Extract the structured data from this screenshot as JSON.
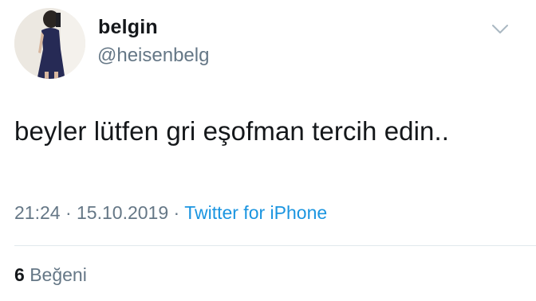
{
  "tweet": {
    "author": {
      "display_name": "belgin",
      "handle": "@heisenbelg",
      "avatar_icon": "profile-photo"
    },
    "menu_icon": "chevron-down-icon",
    "text": "beyler lütfen gri eşofman tercih edin..",
    "time": "21:24",
    "date": "15.10.2019",
    "separator": "·",
    "source": "Twitter for iPhone",
    "likes": {
      "count": "6",
      "label": "Beğeni"
    },
    "colors": {
      "text": "#14171a",
      "secondary": "#657786",
      "link": "#1b95e0",
      "divider": "#e1e8ed"
    }
  }
}
